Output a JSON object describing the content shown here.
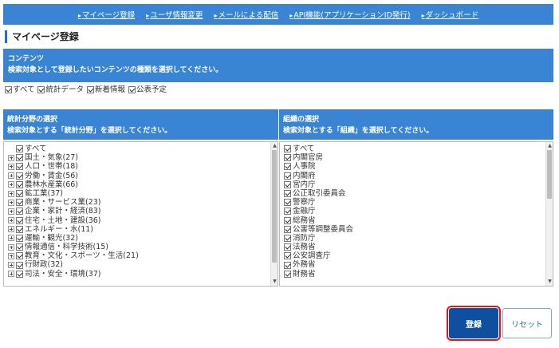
{
  "nav": {
    "links": [
      {
        "label": "マイページ登録"
      },
      {
        "label": "ユーザ情報変更"
      },
      {
        "label": "メールによる配信"
      },
      {
        "label": "API機能(アプリケーションID発行)"
      },
      {
        "label": "ダッシュボード"
      }
    ],
    "arrow": "▸"
  },
  "page_title": "マイページ登録",
  "contents": {
    "heading": "コンテンツ",
    "instruction": "検索対象として登録したいコンテンツの種類を選択してください。",
    "options": [
      {
        "label": "すべて",
        "checked": true
      },
      {
        "label": "統計データ",
        "checked": true
      },
      {
        "label": "新着情報",
        "checked": true
      },
      {
        "label": "公表予定",
        "checked": true
      }
    ]
  },
  "stats_field": {
    "heading": "統計分野の選択",
    "instruction": "検索対象とする「統計分野」を選択してください。",
    "items": [
      {
        "label": "すべて",
        "expandable": false,
        "checked": true
      },
      {
        "label": "国土・気象(27)",
        "expandable": true,
        "checked": true
      },
      {
        "label": "人口・世帯(18)",
        "expandable": true,
        "checked": true
      },
      {
        "label": "労働・賃金(56)",
        "expandable": true,
        "checked": true
      },
      {
        "label": "農林水産業(66)",
        "expandable": true,
        "checked": true
      },
      {
        "label": "鉱工業(37)",
        "expandable": true,
        "checked": true
      },
      {
        "label": "商業・サービス業(23)",
        "expandable": true,
        "checked": true
      },
      {
        "label": "企業・家計・経済(83)",
        "expandable": true,
        "checked": true
      },
      {
        "label": "住宅・土地・建設(36)",
        "expandable": true,
        "checked": true
      },
      {
        "label": "エネルギー・水(11)",
        "expandable": true,
        "checked": true
      },
      {
        "label": "運輸・観光(32)",
        "expandable": true,
        "checked": true
      },
      {
        "label": "情報通信・科学技術(15)",
        "expandable": true,
        "checked": true
      },
      {
        "label": "教育・文化・スポーツ・生活(21)",
        "expandable": true,
        "checked": true
      },
      {
        "label": "行財政(32)",
        "expandable": true,
        "checked": true
      },
      {
        "label": "司法・安全・環境(37)",
        "expandable": true,
        "checked": true
      }
    ],
    "scroll_fraction": 0.88
  },
  "organization": {
    "heading": "組織の選択",
    "instruction": "検索対象とする「組織」を選択してください。",
    "items": [
      {
        "label": "すべて",
        "checked": true
      },
      {
        "label": "内閣官房",
        "checked": true
      },
      {
        "label": "人事院",
        "checked": true
      },
      {
        "label": "内閣府",
        "checked": true
      },
      {
        "label": "宮内庁",
        "checked": true
      },
      {
        "label": "公正取引委員会",
        "checked": true
      },
      {
        "label": "警察庁",
        "checked": true
      },
      {
        "label": "金融庁",
        "checked": true
      },
      {
        "label": "総務省",
        "checked": true
      },
      {
        "label": "公害等調整委員会",
        "checked": true
      },
      {
        "label": "消防庁",
        "checked": true
      },
      {
        "label": "法務省",
        "checked": true
      },
      {
        "label": "公安調査庁",
        "checked": true
      },
      {
        "label": "外務省",
        "checked": true
      },
      {
        "label": "財務省",
        "checked": true
      }
    ],
    "scroll_fraction": 0.38
  },
  "buttons": {
    "register": "登録",
    "reset": "リセット"
  }
}
